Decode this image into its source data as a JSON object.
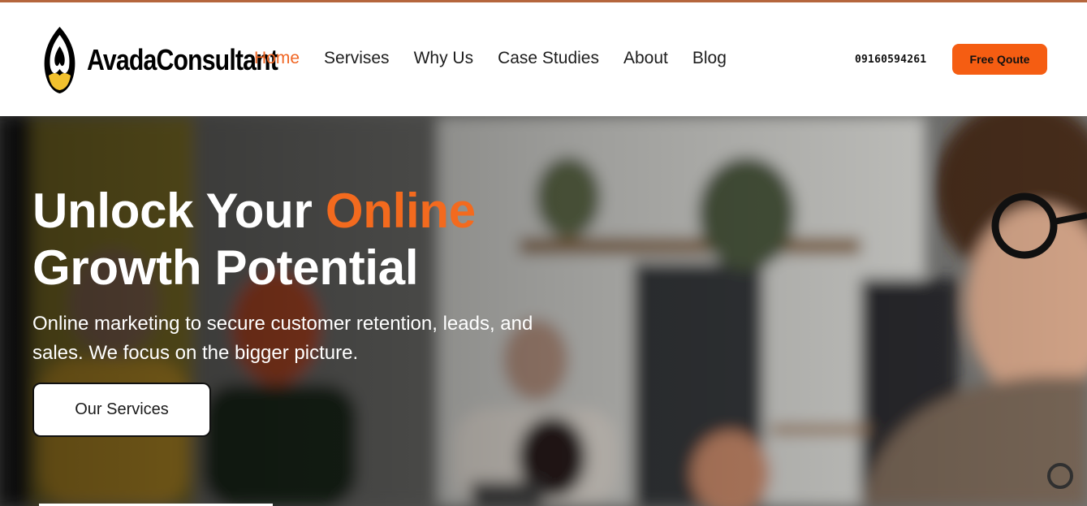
{
  "brand": {
    "name": "AvadaConsultant",
    "icon": "flame-logo-icon",
    "accent_color": "#f06522"
  },
  "nav": {
    "items": [
      {
        "label": "Home",
        "active": true
      },
      {
        "label": "Servises",
        "active": false
      },
      {
        "label": "Why Us",
        "active": false
      },
      {
        "label": "Case Studies",
        "active": false
      },
      {
        "label": "About",
        "active": false
      },
      {
        "label": "Blog",
        "active": false
      }
    ]
  },
  "header": {
    "phone": "09160594261",
    "quote_label": "Free Qoute",
    "quote_color": "#f55d12"
  },
  "hero": {
    "headline_part1": "Unlock Your ",
    "headline_accent": "Online",
    "headline_part2": "Growth Potential",
    "subtext": "Online marketing to secure customer retention, leads, and sales. We focus on the bigger picture.",
    "cta_label": "Our Services",
    "headline_accent_color": "#f36a1e"
  }
}
